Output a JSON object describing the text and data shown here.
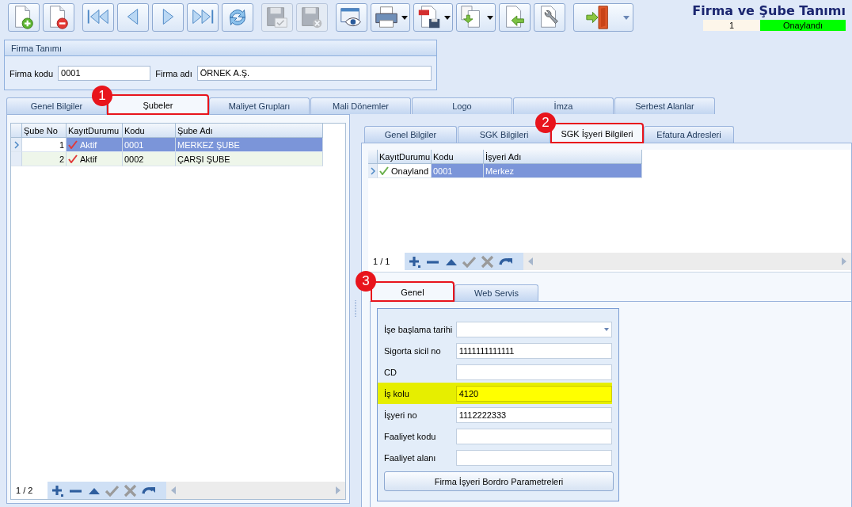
{
  "toolbar": [
    {
      "kind": "new",
      "disabled": false,
      "dropdown": false
    },
    {
      "kind": "delete",
      "disabled": false,
      "dropdown": false
    },
    {
      "kind": "first",
      "disabled": false,
      "dropdown": false
    },
    {
      "kind": "prev",
      "disabled": false,
      "dropdown": false
    },
    {
      "kind": "next",
      "disabled": false,
      "dropdown": false
    },
    {
      "kind": "last",
      "disabled": false,
      "dropdown": false
    },
    {
      "kind": "refresh",
      "disabled": false,
      "dropdown": false
    },
    {
      "kind": "save",
      "disabled": true,
      "dropdown": false
    },
    {
      "kind": "cancel",
      "disabled": true,
      "dropdown": false
    },
    {
      "kind": "preview",
      "disabled": false,
      "dropdown": false
    },
    {
      "kind": "print",
      "disabled": false,
      "dropdown": true
    },
    {
      "kind": "pdf",
      "disabled": false,
      "dropdown": true
    },
    {
      "kind": "copy",
      "disabled": false,
      "dropdown": true
    },
    {
      "kind": "import",
      "disabled": false,
      "dropdown": false
    },
    {
      "kind": "tools",
      "disabled": false,
      "dropdown": false
    },
    {
      "kind": "exit",
      "disabled": false,
      "dropdown": true
    }
  ],
  "header": {
    "title": "Firma ve Şube Tanımı",
    "record_number": "1",
    "status": "Onaylandı"
  },
  "company_panel": {
    "title": "Firma Tanımı",
    "fields": [
      {
        "label": "Firma kodu",
        "value": "0001"
      },
      {
        "label": "Firma adı",
        "value": "ÖRNEK A.Ş."
      }
    ]
  },
  "main_tabs": [
    {
      "label": "Genel Bilgiler",
      "selected": false,
      "highlighted": false
    },
    {
      "label": "Şubeler",
      "selected": true,
      "highlighted": true,
      "callout": "1"
    },
    {
      "label": "Maliyet Grupları",
      "selected": false,
      "highlighted": false
    },
    {
      "label": "Mali Dönemler",
      "selected": false,
      "highlighted": false
    },
    {
      "label": "Logo",
      "selected": false,
      "highlighted": false
    },
    {
      "label": "İmza",
      "selected": false,
      "highlighted": false
    },
    {
      "label": "Serbest Alanlar",
      "selected": false,
      "highlighted": false
    }
  ],
  "branches_grid": {
    "columns": [
      "Şube No",
      "KayıtDurumu",
      "Kodu",
      "Şube Adı"
    ],
    "rows": [
      {
        "selected": true,
        "cells": [
          "1",
          "Aktif",
          "0001",
          "MERKEZ ŞUBE"
        ]
      },
      {
        "selected": false,
        "cells": [
          "2",
          "Aktif",
          "0002",
          "ÇARŞI ŞUBE"
        ]
      }
    ],
    "pager": "1 / 2",
    "actions": [
      {
        "kind": "add",
        "disabled": false
      },
      {
        "kind": "remove",
        "disabled": false
      },
      {
        "kind": "up",
        "disabled": false
      },
      {
        "kind": "confirm",
        "disabled": true
      },
      {
        "kind": "cancel",
        "disabled": true
      },
      {
        "kind": "redo",
        "disabled": false
      }
    ]
  },
  "sub_tabs": [
    {
      "label": "Genel Bilgiler",
      "selected": false,
      "highlighted": false
    },
    {
      "label": "SGK Bilgileri",
      "selected": false,
      "highlighted": false
    },
    {
      "label": "SGK İşyeri Bilgileri",
      "selected": true,
      "highlighted": true,
      "callout": "2"
    },
    {
      "label": "Efatura Adresleri",
      "selected": false,
      "highlighted": false
    }
  ],
  "workplace_grid": {
    "columns": [
      "KayıtDurumu",
      "Kodu",
      "İşyeri Adı"
    ],
    "rows": [
      {
        "selected": true,
        "cells": [
          "Onayland",
          "0001",
          "Merkez"
        ]
      }
    ],
    "pager": "1 / 1",
    "actions": [
      {
        "kind": "add",
        "disabled": false
      },
      {
        "kind": "remove",
        "disabled": false
      },
      {
        "kind": "up",
        "disabled": false
      },
      {
        "kind": "confirm",
        "disabled": true
      },
      {
        "kind": "cancel",
        "disabled": true
      },
      {
        "kind": "redo",
        "disabled": false
      }
    ]
  },
  "detail_tabs": [
    {
      "label": "Genel",
      "selected": true,
      "highlighted": true,
      "callout": "3"
    },
    {
      "label": "Web Servis",
      "selected": false,
      "highlighted": false
    }
  ],
  "form": {
    "fields": [
      {
        "label": "İşe başlama tarihi",
        "kind": "dropdown",
        "highlighted": false
      },
      {
        "label": "Sigorta sicil no",
        "kind": "text",
        "value": "1111111111111",
        "highlighted": false
      },
      {
        "label": "CD",
        "kind": "text",
        "highlighted": false
      },
      {
        "label": "İş kolu",
        "kind": "text",
        "value": "4120",
        "highlighted": true
      },
      {
        "label": "İşyeri no",
        "kind": "text",
        "value": "1112222333",
        "highlighted": false
      },
      {
        "label": "Faaliyet kodu",
        "kind": "text",
        "highlighted": false
      },
      {
        "label": "Faaliyet alanı",
        "kind": "text",
        "highlighted": false
      }
    ],
    "button": "Firma İşyeri Bordro Parametreleri"
  }
}
